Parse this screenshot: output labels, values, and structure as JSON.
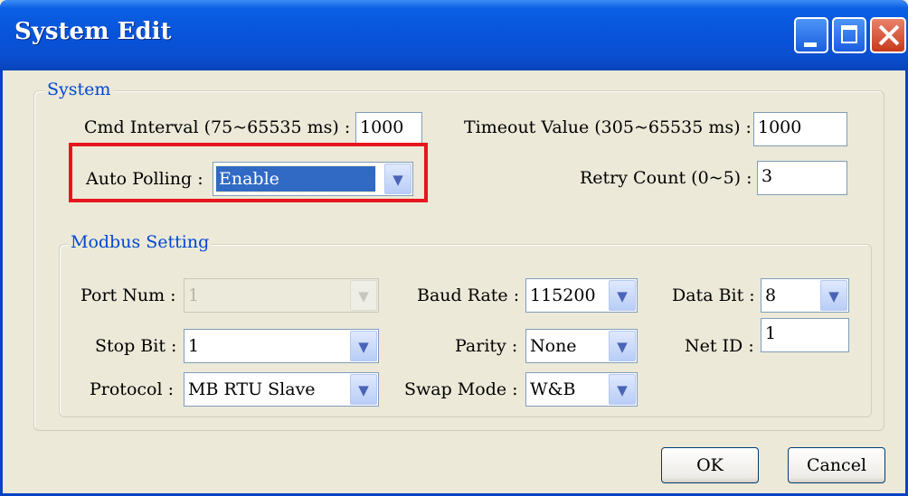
{
  "window": {
    "title": "System Edit",
    "controls": [
      "minimize-icon",
      "maximize-icon",
      "close-icon"
    ]
  },
  "system": {
    "legend": "System",
    "cmd_interval_label": "Cmd Interval (75~65535 ms) :",
    "cmd_interval_value": "1000",
    "timeout_label": "Timeout Value (305~65535 ms) :",
    "timeout_value": "1000",
    "auto_polling_label": "Auto Polling :",
    "auto_polling_value": "Enable",
    "retry_label": "Retry Count (0~5) :",
    "retry_value": "3"
  },
  "modbus": {
    "legend": "Modbus Setting",
    "port_num_label": "Port Num :",
    "port_num_value": "1",
    "baud_rate_label": "Baud Rate :",
    "baud_rate_value": "115200",
    "data_bit_label": "Data Bit :",
    "data_bit_value": "8",
    "stop_bit_label": "Stop Bit :",
    "stop_bit_value": "1",
    "parity_label": "Parity :",
    "parity_value": "None",
    "net_id_label": "Net ID :",
    "net_id_value": "1",
    "protocol_label": "Protocol :",
    "protocol_value": "MB RTU Slave",
    "swap_mode_label": "Swap Mode :",
    "swap_mode_value": "W&B"
  },
  "buttons": {
    "ok": "OK",
    "cancel": "Cancel"
  },
  "colors": {
    "titlebar": "#0a5fe4",
    "highlight": "#e6161d",
    "legend_text": "#0046d5",
    "dialog_bg": "#ece9d8"
  }
}
